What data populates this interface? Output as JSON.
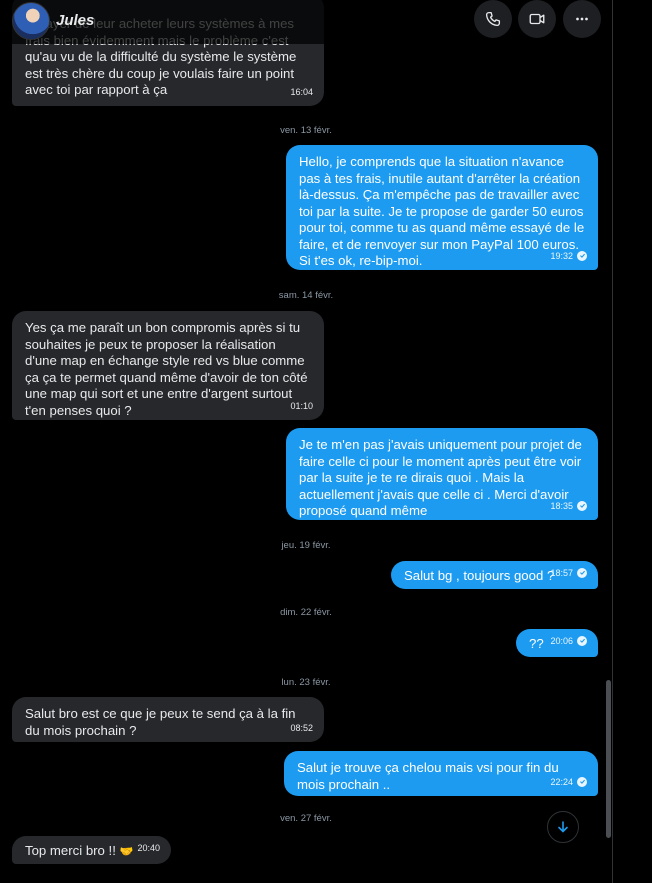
{
  "header": {
    "contact_name": "Jules",
    "buttons": {
      "call": "phone-icon",
      "video": "video-icon",
      "more": "more-icon"
    }
  },
  "messages": [
    {
      "side": "in",
      "text": "essayer de leur acheter leurs systèmes à mes frais bien évidemment mais le problème c'est qu'au vu de la difficulté du système le système est très chère du coup je voulais faire un point avec toi par rapport à ça",
      "time": "16:04"
    },
    {
      "side": "out",
      "text": "Hello, je comprends que la situation n'avance pas à tes frais, inutile autant d'arrêter la création là-dessus. Ça m'empêche pas de travailler avec toi par la suite. Je te propose de garder 50 euros pour toi, comme tu as quand même essayé de le faire, et de renvoyer sur mon PayPal 100 euros. Si t'es ok, re-bip-moi.",
      "time": "19:32"
    },
    {
      "side": "in",
      "text": "Yes ça me paraît un bon compromis après si tu souhaites je peux te proposer la réalisation d'une map en échange style red vs blue comme ça ça te permet quand même d'avoir de ton côté une map qui sort et une entre d'argent surtout t'en penses quoi ?",
      "time": "01:10"
    },
    {
      "side": "out",
      "text": "Je te m'en pas j'avais uniquement pour projet de faire celle ci pour le moment après peut être voir par la suite je te re dirais quoi . Mais la actuellement j'avais que celle ci . Merci d'avoir proposé quand même",
      "time": "18:35"
    },
    {
      "side": "out",
      "text": "Salut bg , toujours good ?",
      "time": "18:57"
    },
    {
      "side": "out",
      "text": "??",
      "time": "20:06"
    },
    {
      "side": "in",
      "text": "Salut bro est ce que je peux te send ça à la fin du mois prochain ?",
      "time": "08:52"
    },
    {
      "side": "out",
      "text": "Salut je trouve ça chelou mais vsi pour fin du mois prochain ..",
      "time": "22:24"
    },
    {
      "side": "in",
      "text": "Top merci bro !!",
      "emoji": "🤝",
      "time": "20:40"
    }
  ],
  "dates": [
    "ven. 13 févr.",
    "sam. 14 févr.",
    "jeu. 19 févr.",
    "dim. 22 févr.",
    "lun. 23 févr.",
    "ven. 27 févr."
  ],
  "colors": {
    "outgoing": "#1d9bf0",
    "incoming": "#26282c",
    "background": "#000000"
  }
}
